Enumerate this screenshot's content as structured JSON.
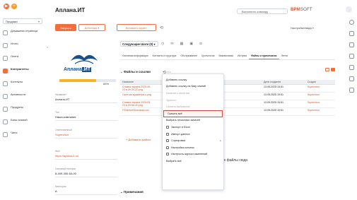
{
  "header": {
    "title": "Аплана.ИТ",
    "command_placeholder": "Выполнить команду",
    "brand_main": "BPM",
    "brand_sub": "SOFT"
  },
  "sidebar": {
    "select_value": "Продажи",
    "items": [
      {
        "label": "Домашняя страница"
      },
      {
        "label": "Итоги"
      },
      {
        "label": "Лента"
      },
      {
        "label": "Контрагенты"
      },
      {
        "label": "Контакты"
      },
      {
        "label": "Активности"
      },
      {
        "label": "Продукты"
      },
      {
        "label": "Базы знаний"
      },
      {
        "label": "Чаты"
      }
    ]
  },
  "toolbar": {
    "close": "Закрыть",
    "actions": "Действия",
    "insert_script": "Вставить скрипт",
    "view_settings": "Настройка вида"
  },
  "account": {
    "logo_text_a": "Аплана",
    "logo_text_b": ".ИТ",
    "progress": 0.65,
    "progress_label": "65%",
    "fields": [
      {
        "label": "Название*",
        "value": "Аплана.ИТ",
        "link": false
      },
      {
        "label": "Тип",
        "value": "Наша компания",
        "link": false
      },
      {
        "label": "Ответственный",
        "value": "Supervisor",
        "link": true
      },
      {
        "label": "Web",
        "value": "https://aplana-it.ru/",
        "link": true
      },
      {
        "label": "Основной телефон",
        "value": "8-499-330-63-00",
        "link": false
      },
      {
        "label": "Категория",
        "value": "А",
        "link": false
      }
    ]
  },
  "main": {
    "next_steps": "Следующие Шаги (0)",
    "tabs": [
      "Основная информация",
      "Контакты и структура",
      "Обслуживание",
      "Хронология",
      "Взаимосвязи",
      "История",
      "Файлы и примечания",
      "Лента"
    ],
    "active_tab": "Файлы и примечания",
    "files_title": "Файлы и ссылки",
    "columns": [
      "Название",
      "Дата создания",
      "Создал"
    ],
    "rows": [
      {
        "name": "Снимок экрана 2025-05-23 в 09.25.22.png",
        "date": "13.05.2025 15:51",
        "author": "Supervisor"
      },
      {
        "name": "Скептик шраметра.с.png",
        "date": "13.05.2025 15:51",
        "author": "Supervisor"
      },
      {
        "name": "Снимок экрана 2025-05-23 в 09.58.40.png",
        "date": "13.05.2025 15:51",
        "author": "Supervisor"
      },
      {
        "name": "ПСfavtiveDownload.csv",
        "date": "13.05.2025 15:51",
        "author": "Supervisor"
      }
    ],
    "add_files": "+ Добавить файлы",
    "drop_hint": "ьте файлы сюда",
    "notes_title": "Примечания"
  },
  "menu": {
    "items": [
      {
        "label": "Добавить ссылку",
        "disabled": false,
        "icon": false,
        "submenu": false
      },
      {
        "label": "Добавить ссылку на базу знаний",
        "disabled": false,
        "icon": false,
        "submenu": false
      },
      {
        "label": "Изменить свойства",
        "disabled": true,
        "icon": false,
        "submenu": false
      },
      {
        "label": "Удалить",
        "disabled": true,
        "icon": false,
        "submenu": false
      },
      {
        "label": "Скачать выбранное",
        "disabled": true,
        "icon": false,
        "submenu": false
      },
      {
        "label": "Скачать всё",
        "disabled": false,
        "icon": false,
        "submenu": false,
        "highlighted": true
      },
      {
        "label": "Выбрать несколько записей",
        "disabled": false,
        "icon": false,
        "submenu": false
      },
      {
        "label": "Экспорт в Excel",
        "disabled": false,
        "icon": true,
        "submenu": false
      },
      {
        "label": "Импорт данных",
        "disabled": false,
        "icon": true,
        "submenu": false
      },
      {
        "label": "Сортировка",
        "disabled": false,
        "icon": true,
        "submenu": true
      },
      {
        "label": "Настройка колонок",
        "disabled": false,
        "icon": true,
        "submenu": false
      },
      {
        "label": "Настроить журнал изменений",
        "disabled": false,
        "icon": true,
        "submenu": false
      },
      {
        "label": "Выбрать всё",
        "disabled": false,
        "icon": false,
        "submenu": false
      }
    ]
  },
  "colors": {
    "accent": "#f26e3b",
    "link": "#d4542b",
    "progress": "#f4b32b",
    "highlight_border": "#d44a3a"
  }
}
